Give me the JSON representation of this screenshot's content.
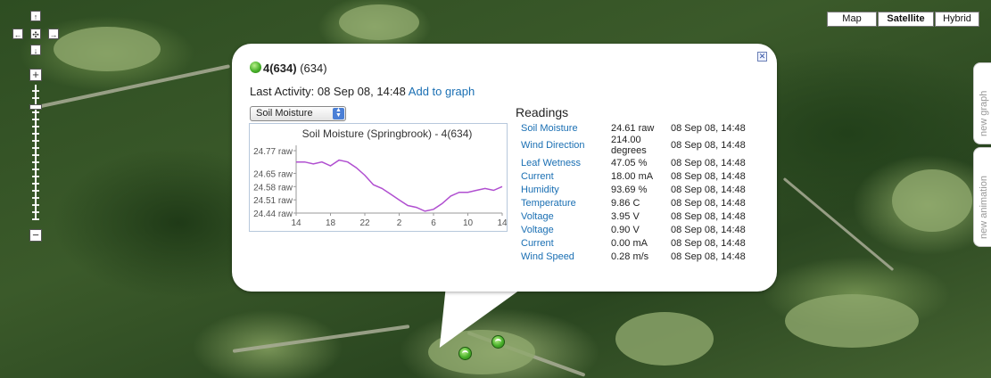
{
  "map_types": [
    {
      "label": "Map",
      "active": false
    },
    {
      "label": "Satellite",
      "active": true
    },
    {
      "label": "Hybrid",
      "active": false
    }
  ],
  "side_tabs": {
    "new_graph": "new graph",
    "new_animation": "new animation"
  },
  "controls": {
    "pan_up": "↑",
    "pan_left": "←",
    "pan_center": "✣",
    "pan_right": "→",
    "pan_down": "↓",
    "zoom_in": "+",
    "zoom_out": "−"
  },
  "info_window": {
    "close": "✕",
    "node_name": "4(634)",
    "node_id": "(634)",
    "last_activity_label": "Last Activity: 08 Sep 08, 14:48",
    "add_to_graph": "Add to graph",
    "sensor_select": "Soil Moisture",
    "readings_title": "Readings",
    "readings": [
      {
        "name": "Soil Moisture",
        "value": "24.61 raw",
        "time": "08 Sep 08, 14:48"
      },
      {
        "name": "Wind Direction",
        "value": "214.00 degrees",
        "time": "08 Sep 08, 14:48"
      },
      {
        "name": "Leaf Wetness",
        "value": "47.05 %",
        "time": "08 Sep 08, 14:48"
      },
      {
        "name": "Current",
        "value": "18.00 mA",
        "time": "08 Sep 08, 14:48"
      },
      {
        "name": "Humidity",
        "value": "93.69 %",
        "time": "08 Sep 08, 14:48"
      },
      {
        "name": "Temperature",
        "value": "9.86 C",
        "time": "08 Sep 08, 14:48"
      },
      {
        "name": "Voltage",
        "value": "3.95 V",
        "time": "08 Sep 08, 14:48"
      },
      {
        "name": "Voltage",
        "value": "0.90 V",
        "time": "08 Sep 08, 14:48"
      },
      {
        "name": "Current",
        "value": "0.00 mA",
        "time": "08 Sep 08, 14:48"
      },
      {
        "name": "Wind Speed",
        "value": "0.28 m/s",
        "time": "08 Sep 08, 14:48"
      }
    ]
  },
  "chart_data": {
    "type": "line",
    "title": "Soil Moisture (Springbrook) - 4(634)",
    "x_tick_labels": [
      "14",
      "18",
      "22",
      "2",
      "6",
      "10",
      "14"
    ],
    "y_tick_labels": [
      "24.77 raw",
      "24.65 raw",
      "24.58 raw",
      "24.51 raw",
      "24.44 raw"
    ],
    "y_ticks": [
      24.77,
      24.65,
      24.58,
      24.51,
      24.44
    ],
    "ylim": [
      24.44,
      24.77
    ],
    "x_hours_elapsed_range": [
      0,
      24
    ],
    "color": "#b04fd0",
    "series": [
      {
        "x": [
          0,
          1,
          2,
          3,
          4,
          5,
          6,
          7,
          8,
          9,
          10,
          11,
          12,
          13,
          14,
          15,
          16,
          17,
          18,
          19,
          20,
          21,
          22,
          23,
          24
        ],
        "y": [
          24.71,
          24.71,
          24.7,
          24.71,
          24.69,
          24.72,
          24.71,
          24.68,
          24.64,
          24.59,
          24.57,
          24.54,
          24.51,
          24.48,
          24.47,
          24.45,
          24.46,
          24.49,
          24.53,
          24.55,
          24.55,
          24.56,
          24.57,
          24.56,
          24.58
        ]
      }
    ]
  },
  "colors": {
    "link": "#1a6fb3",
    "marker": "#48b02a",
    "line": "#b04fd0"
  }
}
